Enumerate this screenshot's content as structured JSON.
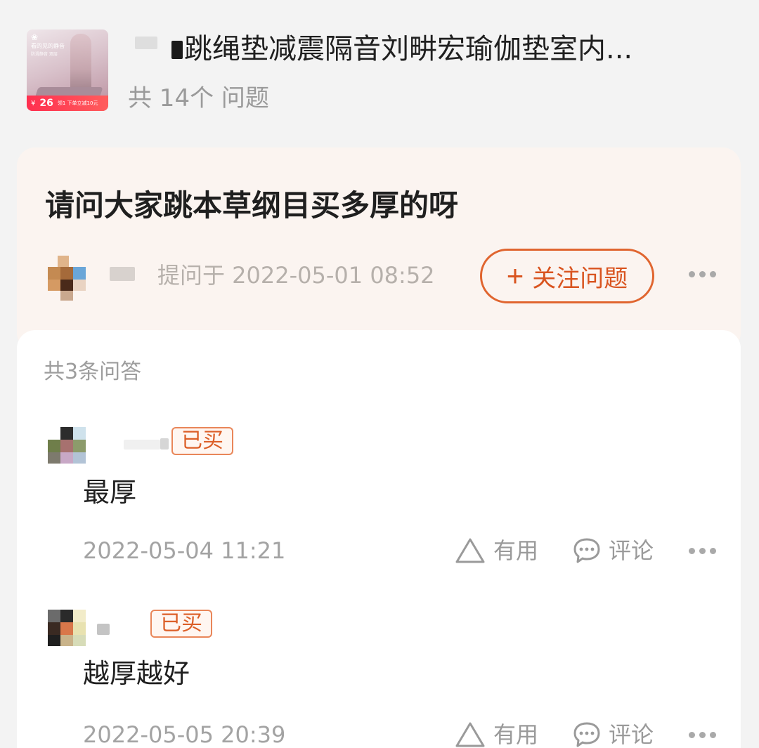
{
  "product": {
    "thumbnail": {
      "logo": "❀",
      "caption": "看的见的静音",
      "subcaption": "防滑静音 双层",
      "price": "26",
      "price_unit": "¥",
      "promo": "领1  下单立减10元"
    },
    "title": "跳绳垫减震隔音刘畊宏瑜伽垫室内...",
    "question_count": "共 14个 问题"
  },
  "question": {
    "title": "请问大家跳本草纲目买多厚的呀",
    "asked_at": "提问于 2022-05-01 08:52",
    "follow_label": "关注问题",
    "follow_icon": "plus-icon"
  },
  "answers_section": {
    "count_label": "共3条问答",
    "answers": [
      {
        "badge": "已买",
        "text": "最厚",
        "time": "2022-05-04 11:21",
        "useful_label": "有用",
        "comment_label": "评论"
      },
      {
        "badge": "已买",
        "text": "越厚越好",
        "time": "2022-05-05 20:39",
        "useful_label": "有用",
        "comment_label": "评论"
      }
    ]
  },
  "colors": {
    "accent": "#e0652f",
    "question_card_bg": "#fbf4f0",
    "page_bg": "#f3f3f3"
  }
}
